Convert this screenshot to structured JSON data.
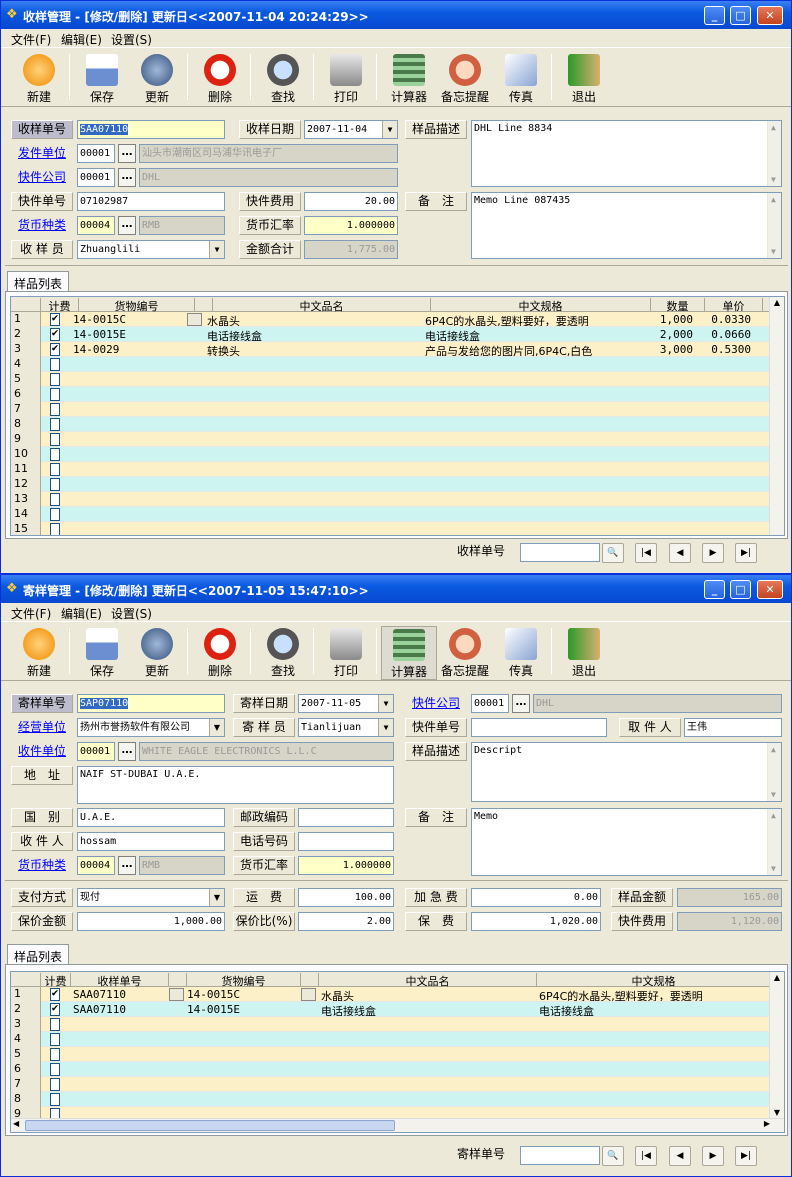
{
  "win1": {
    "title": "收样管理 - [修改/删除]  更新日<<2007-11-04 20:24:29>>",
    "menu": [
      "文件(F)",
      "编辑(E)",
      "设置(S)"
    ],
    "toolbar": [
      "新建",
      "保存",
      "更新",
      "删除",
      "查找",
      "打印",
      "计算器",
      "备忘提醒",
      "传真",
      "退出"
    ],
    "form": {
      "no_label": "收样单号",
      "no": "SAA07110",
      "date_label": "收样日期",
      "date": "2007-11-04",
      "desc_label": "样品描述",
      "desc": "DHL Line 8834",
      "sender_label": "发件单位",
      "sender_code": "00001",
      "sender_name": "汕头市潮南区司马浦华讯电子厂",
      "express_label": "快件公司",
      "express_code": "00001",
      "express_name": "DHL",
      "track_label": "快件单号",
      "track": "07102987",
      "fee_label": "快件费用",
      "fee": "20.00",
      "remark_label": "备　注",
      "remark": "Memo Line 087435",
      "cur_label": "货币种类",
      "cur_code": "00004",
      "cur_name": "RMB",
      "rate_label": "货币汇率",
      "rate": "1.000000",
      "recv_label": "收 样 员",
      "recv": "Zhuanglili",
      "total_label": "金额合计",
      "total": "1,775.00"
    },
    "tab": "样品列表",
    "grid": {
      "headers": [
        "计费",
        "货物编号",
        "中文品名",
        "中文规格",
        "数量",
        "单价"
      ],
      "rows": [
        {
          "n": "1",
          "chk": true,
          "code": "14-0015C",
          "name": "水晶头",
          "spec": "6P4C的水晶头,塑料要好，要透明",
          "qty": "1,000",
          "price": "0.0330"
        },
        {
          "n": "2",
          "chk": true,
          "code": "14-0015E",
          "name": "电话接线盒",
          "spec": "电话接线盒",
          "qty": "2,000",
          "price": "0.0660"
        },
        {
          "n": "3",
          "chk": true,
          "code": "14-0029",
          "name": "转换头",
          "spec": "产品与发给您的图片同,6P4C,白色",
          "qty": "3,000",
          "price": "0.5300"
        },
        {
          "n": "4"
        },
        {
          "n": "5"
        },
        {
          "n": "6"
        },
        {
          "n": "7"
        },
        {
          "n": "8"
        },
        {
          "n": "9"
        },
        {
          "n": "10"
        },
        {
          "n": "11"
        },
        {
          "n": "12"
        },
        {
          "n": "13"
        },
        {
          "n": "14"
        },
        {
          "n": "15"
        }
      ]
    },
    "search_label": "收样单号"
  },
  "win2": {
    "title": "寄样管理 - [修改/删除]  更新日<<2007-11-05 15:47:10>>",
    "menu": [
      "文件(F)",
      "编辑(E)",
      "设置(S)"
    ],
    "toolbar": [
      "新建",
      "保存",
      "更新",
      "删除",
      "查找",
      "打印",
      "计算器",
      "备忘提醒",
      "传真",
      "退出"
    ],
    "form": {
      "no_label": "寄样单号",
      "no": "SAP07110",
      "date_label": "寄样日期",
      "date": "2007-11-05",
      "express_label": "快件公司",
      "express_code": "00001",
      "express_name": "DHL",
      "dealer_label": "经营单位",
      "dealer": "扬州市誉扬软件有限公司",
      "sender_label": "寄 样 员",
      "sender": "Tianlijuan",
      "track_label": "快件单号",
      "track": "",
      "pick_label": "取 件 人",
      "pick": "王伟",
      "recvunit_label": "收件单位",
      "recvunit_code": "00001",
      "recvunit_name": "WHITE EAGLE ELECTRONICS L.L.C",
      "desc_label": "样品描述",
      "desc": "Descript",
      "addr_label": "地　址",
      "addr": "NAIF ST-DUBAI U.A.E.",
      "country_label": "国　别",
      "country": "U.A.E.",
      "post_label": "邮政编码",
      "post": "",
      "remark_label": "备　注",
      "remark": "Memo",
      "recvp_label": "收 件 人",
      "recvp": "hossam",
      "phone_label": "电话号码",
      "phone": "",
      "cur_label": "货币种类",
      "cur_code": "00004",
      "cur_name": "RMB",
      "rate_label": "货币汇率",
      "rate": "1.000000",
      "pay_label": "支付方式",
      "pay": "现付",
      "ship_label": "运　费",
      "ship": "100.00",
      "urgent_label": "加 急 费",
      "urgent": "0.00",
      "sample_amt_label": "样品金额",
      "sample_amt": "165.00",
      "insured_label": "保价金额",
      "insured": "1,000.00",
      "ratio_label": "保价比(%)",
      "ratio": "2.00",
      "insfee_label": "保　费",
      "insfee": "1,020.00",
      "expfee_label": "快件费用",
      "expfee": "1,120.00"
    },
    "tab": "样品列表",
    "grid": {
      "headers": [
        "计费",
        "收样单号",
        "货物编号",
        "中文品名",
        "中文规格"
      ],
      "rows": [
        {
          "n": "1",
          "chk": true,
          "sno": "SAA07110",
          "code": "14-0015C",
          "name": "水晶头",
          "spec": "6P4C的水晶头,塑料要好，要透明"
        },
        {
          "n": "2",
          "chk": true,
          "sno": "SAA07110",
          "code": "14-0015E",
          "name": "电话接线盒",
          "spec": "电话接线盒"
        },
        {
          "n": "3"
        },
        {
          "n": "4"
        },
        {
          "n": "5"
        },
        {
          "n": "6"
        },
        {
          "n": "7"
        },
        {
          "n": "8"
        },
        {
          "n": "9"
        }
      ]
    },
    "search_label": "寄样单号"
  },
  "colors": {
    "title": "#0a5ae0",
    "row_a": "#fbf0c8",
    "row_b": "#cdf4f0",
    "label_gray": "#bdbccd",
    "yellow_field": "#ffffc8"
  }
}
